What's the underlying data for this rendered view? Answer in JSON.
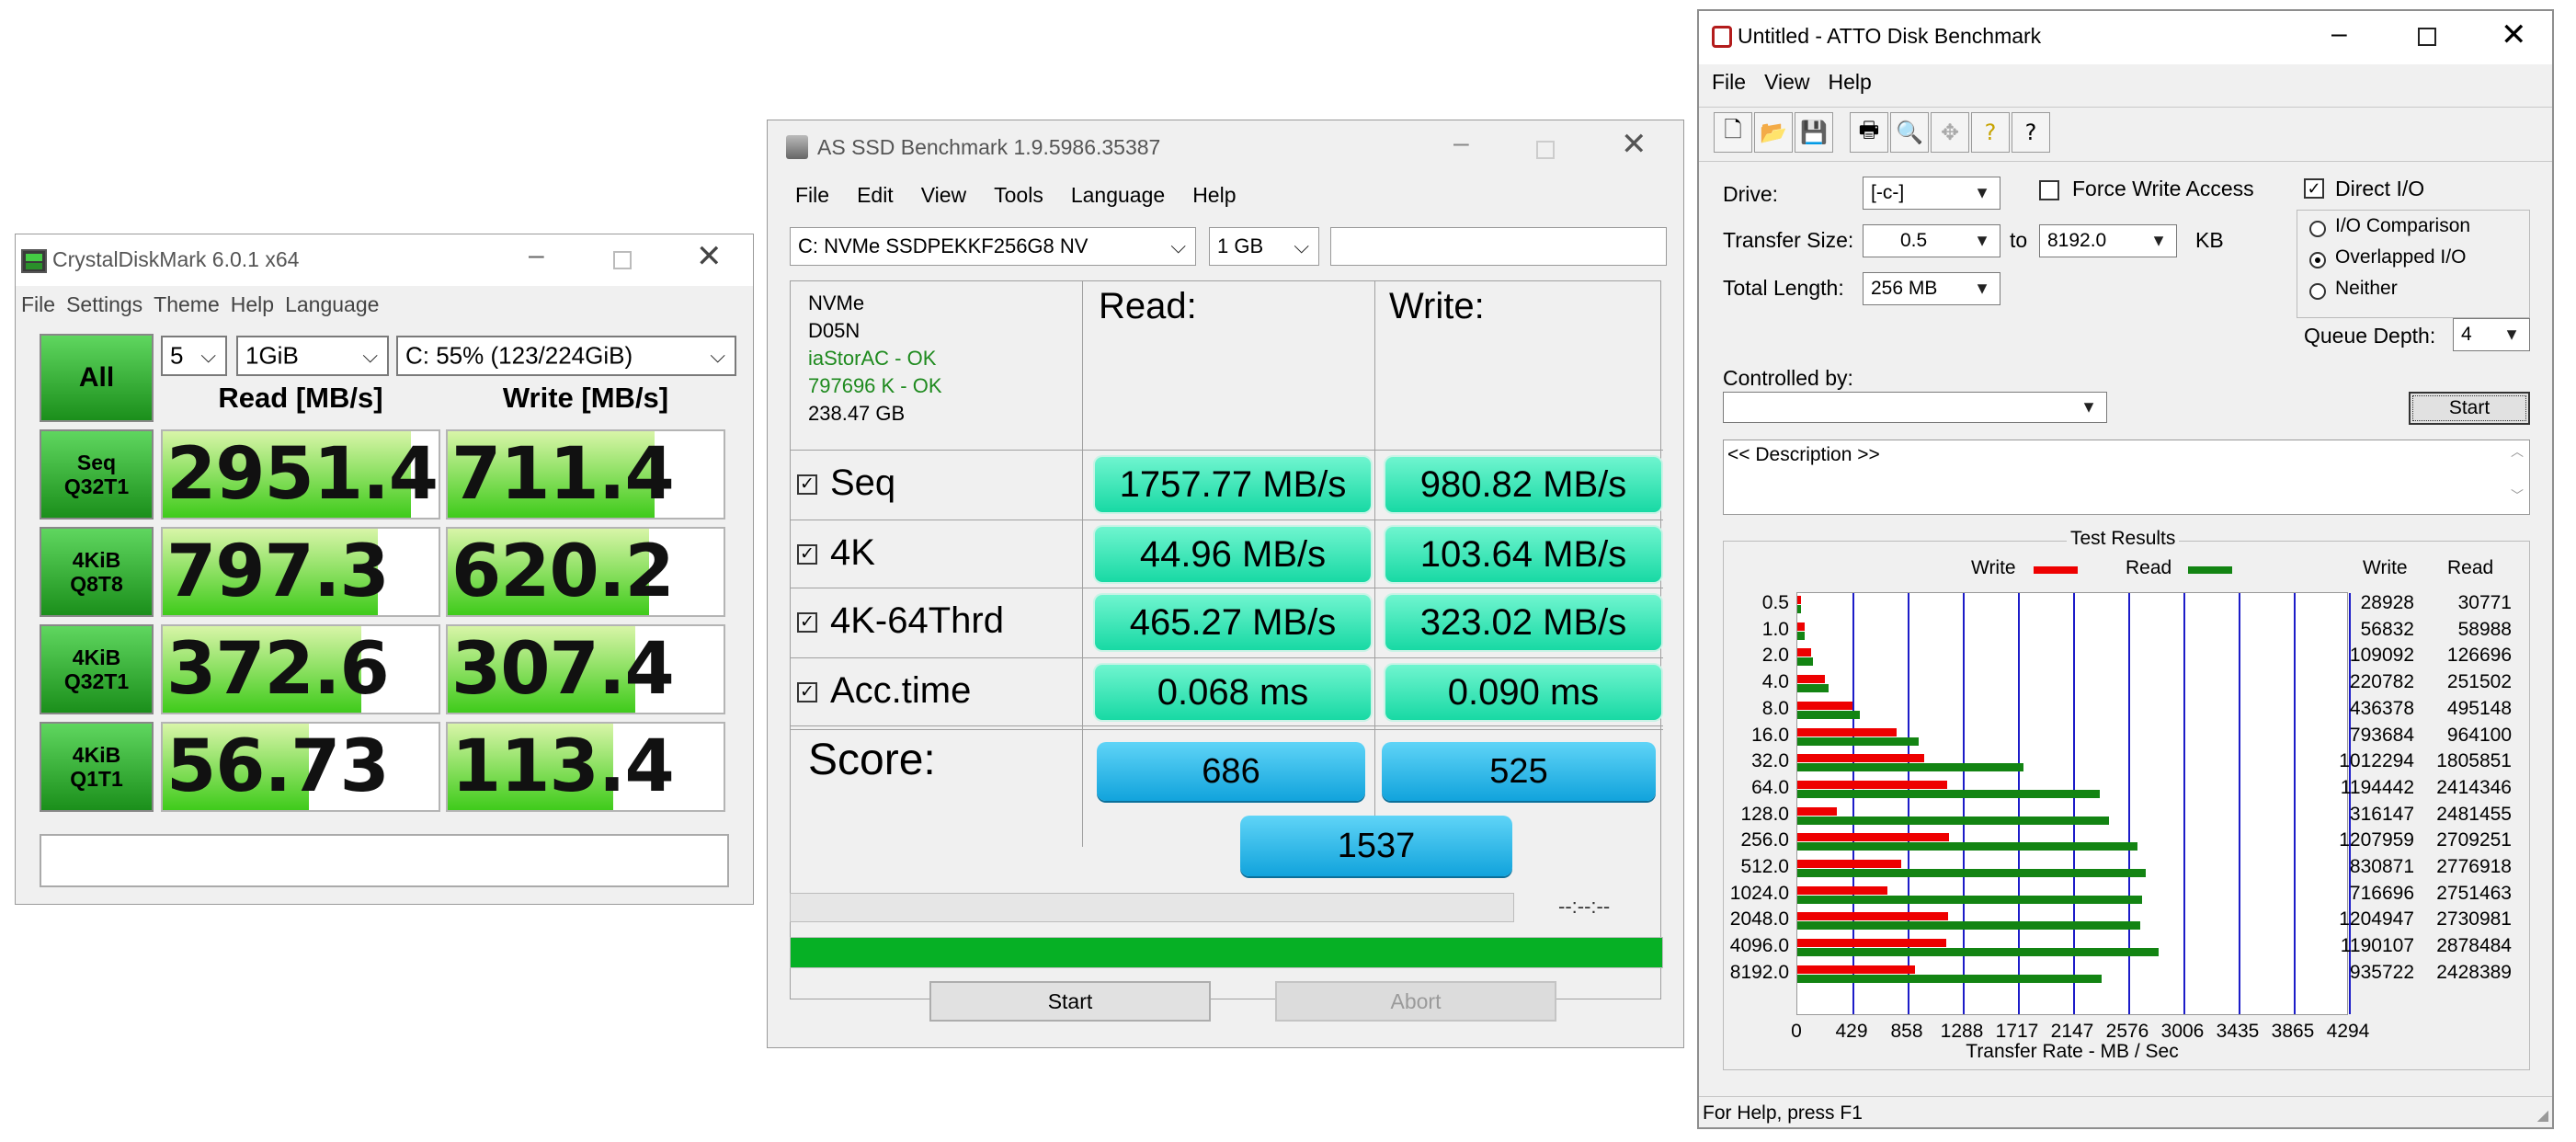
{
  "crystal": {
    "title": "CrystalDiskMark 6.0.1 x64",
    "menu": [
      "File",
      "Settings",
      "Theme",
      "Help",
      "Language"
    ],
    "all_label": "All",
    "count": "5",
    "size": "1GiB",
    "drive": "C: 55% (123/224GiB)",
    "read_header": "Read [MB/s]",
    "write_header": "Write [MB/s]",
    "rows": [
      {
        "line1": "Seq",
        "line2": "Q32T1",
        "read": "2951.4",
        "write": "711.4",
        "read_fill": 0.9,
        "write_fill": 0.75
      },
      {
        "line1": "4KiB",
        "line2": "Q8T8",
        "read": "797.3",
        "write": "620.2",
        "read_fill": 0.78,
        "write_fill": 0.73
      },
      {
        "line1": "4KiB",
        "line2": "Q32T1",
        "read": "372.6",
        "write": "307.4",
        "read_fill": 0.72,
        "write_fill": 0.68
      },
      {
        "line1": "4KiB",
        "line2": "Q1T1",
        "read": "56.73",
        "write": "113.4",
        "read_fill": 0.53,
        "write_fill": 0.6
      }
    ],
    "comment": ""
  },
  "asssd": {
    "title": "AS SSD Benchmark 1.9.5986.35387",
    "menu": [
      "File",
      "Edit",
      "View",
      "Tools",
      "Language",
      "Help"
    ],
    "drive": "C: NVMe SSDPEKKF256G8 NV",
    "size": "1 GB",
    "info": [
      "NVMe",
      "D05N",
      "iaStorAC - OK",
      "797696 K - OK",
      "238.47 GB"
    ],
    "read_header": "Read:",
    "write_header": "Write:",
    "rows": [
      {
        "label": "Seq",
        "read": "1757.77 MB/s",
        "write": "980.82 MB/s"
      },
      {
        "label": "4K",
        "read": "44.96 MB/s",
        "write": "103.64 MB/s"
      },
      {
        "label": "4K-64Thrd",
        "read": "465.27 MB/s",
        "write": "323.02 MB/s"
      },
      {
        "label": "Acc.time",
        "read": "0.068 ms",
        "write": "0.090 ms"
      }
    ],
    "score_label": "Score:",
    "score_read": "686",
    "score_write": "525",
    "score_total": "1537",
    "time_text": "--:--:--",
    "progress": 1.0,
    "start_label": "Start",
    "abort_label": "Abort",
    "colors": {
      "cell": "#2ee3b4",
      "score": "#17aee6",
      "progress": "#06b025"
    }
  },
  "atto": {
    "title": "Untitled - ATTO Disk Benchmark",
    "menu": [
      "File",
      "View",
      "Help"
    ],
    "toolbar_icons": [
      "new-icon",
      "open-icon",
      "save-icon",
      "print-icon",
      "print-preview-icon",
      "move-icon",
      "help-icon",
      "context-help-icon"
    ],
    "drive_label": "Drive:",
    "drive_value": "[-c-]",
    "force_write_label": "Force Write Access",
    "direct_io_label": "Direct I/O",
    "transfer_size_label": "Transfer Size:",
    "transfer_from": "0.5",
    "to_label": "to",
    "transfer_to": "8192.0",
    "kb_label": "KB",
    "total_length_label": "Total Length:",
    "total_length_value": "256 MB",
    "io_options": [
      "I/O Comparison",
      "Overlapped I/O",
      "Neither"
    ],
    "io_selected": "Overlapped I/O",
    "queue_depth_label": "Queue Depth:",
    "queue_depth_value": "4",
    "controlled_by_label": "Controlled by:",
    "controlled_by_value": "",
    "start_label": "Start",
    "description": "<< Description >>",
    "results_title": "Test Results",
    "legend_write": "Write",
    "legend_read": "Read",
    "col_write": "Write",
    "col_read": "Read",
    "status": "For Help, press F1",
    "colors": {
      "write": "#ee0000",
      "read": "#138413",
      "grid": "#1c1cc8"
    }
  },
  "chart_data": {
    "type": "bar",
    "title": "Test Results",
    "xlabel": "Transfer Rate - MB / Sec",
    "ylabel": "",
    "x_ticks": [
      "0",
      "429",
      "858",
      "1288",
      "1717",
      "2147",
      "2576",
      "3006",
      "3435",
      "3865",
      "4294"
    ],
    "xlim": [
      0,
      4294
    ],
    "categories": [
      "0.5",
      "1.0",
      "2.0",
      "4.0",
      "8.0",
      "16.0",
      "32.0",
      "64.0",
      "128.0",
      "256.0",
      "512.0",
      "1024.0",
      "2048.0",
      "4096.0",
      "8192.0"
    ],
    "series": [
      {
        "name": "Write",
        "values": [
          28928,
          56832,
          109092,
          220782,
          436378,
          793684,
          1012294,
          1194442,
          316147,
          1207959,
          830871,
          716696,
          1204947,
          1190107,
          935722
        ],
        "labels": [
          "28928",
          "56832",
          "109092",
          "220782",
          "436378",
          "793684",
          "1012294",
          "1194442",
          "316147",
          "1207959",
          "830871",
          "716696",
          "1204947",
          "1190107",
          "935722"
        ]
      },
      {
        "name": "Read",
        "values": [
          30771,
          58988,
          126696,
          251502,
          495148,
          964100,
          1805851,
          2414346,
          2481455,
          2709251,
          2776918,
          2751463,
          2730981,
          2878484,
          2428389
        ],
        "labels": [
          "30771",
          "58988",
          "126696",
          "251502",
          "495148",
          "964100",
          "1805851",
          "2414346",
          "2481455",
          "2709251",
          "2776918",
          "2751463",
          "2730981",
          "2878484",
          "2428389"
        ]
      }
    ],
    "value_unit": "KB/s",
    "grid": true,
    "legend": "top"
  }
}
